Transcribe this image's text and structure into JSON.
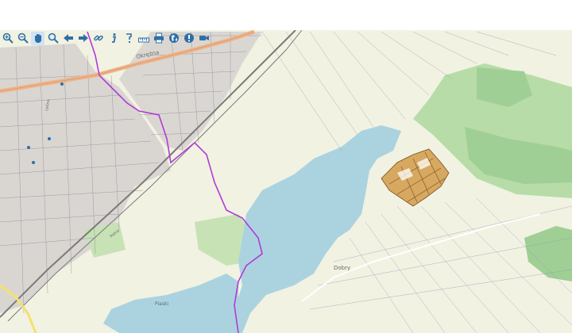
{
  "map": {
    "labels": {
      "road_name": "Okrężna",
      "town_label": "Dobry",
      "pond_label": "Piaski",
      "street_a": "Leśna",
      "street_b": "Polna"
    }
  },
  "toolbar": {
    "tools": [
      {
        "name": "zoom-in-icon"
      },
      {
        "name": "zoom-out-icon"
      },
      {
        "name": "pan-hand-icon"
      },
      {
        "name": "zoom-extent-icon"
      },
      {
        "name": "back-arrow-icon"
      },
      {
        "name": "forward-arrow-icon"
      },
      {
        "name": "link-icon"
      },
      {
        "name": "info-icon"
      },
      {
        "name": "query-icon"
      },
      {
        "name": "measure-icon"
      },
      {
        "name": "print-icon"
      },
      {
        "name": "globe-icon"
      },
      {
        "name": "warning-icon"
      },
      {
        "name": "video-icon"
      }
    ]
  },
  "colors": {
    "land": "#f1f2e2",
    "water": "#abd3df",
    "forest": "#9fcf94",
    "boundary": "#b23ad6",
    "parcel": "#d7a860",
    "road": "#f0b48a",
    "icon": "#2f6fa6"
  }
}
